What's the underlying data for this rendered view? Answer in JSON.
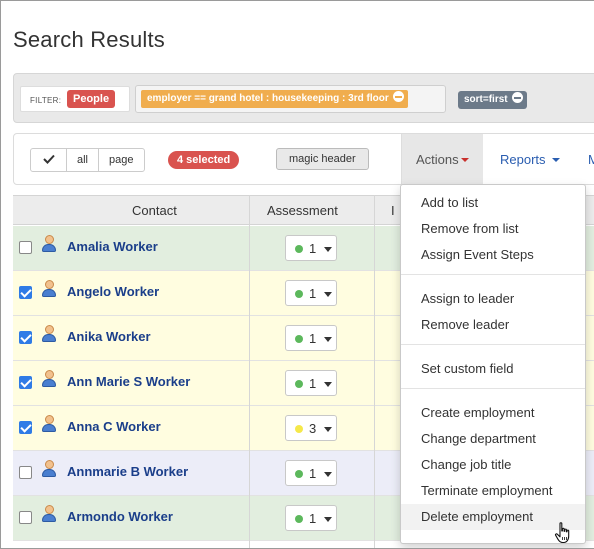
{
  "page": {
    "title": "Search Results"
  },
  "filters": {
    "label": "FILTER:",
    "people_tag": "People",
    "employer_filter": "employer == grand hotel : housekeeping : 3rd floor",
    "sort_tag": "sort=first"
  },
  "toolbar": {
    "check_icon": "checkmark-icon",
    "all_label": "all",
    "page_label": "page",
    "selected_badge": "4 selected",
    "magic_header_label": "magic header",
    "actions_label": "Actions",
    "reports_label": "Reports",
    "more_label": "M"
  },
  "table": {
    "headers": [
      "Contact",
      "Assessment",
      "I"
    ],
    "rows": [
      {
        "name": "Amalia Worker",
        "checked": false,
        "assessment": "1",
        "dot_color": "#5cb85c",
        "row_color": "green"
      },
      {
        "name": "Angelo Worker",
        "checked": true,
        "assessment": "1",
        "dot_color": "#5cb85c",
        "row_color": "yellow"
      },
      {
        "name": "Anika Worker",
        "checked": true,
        "assessment": "1",
        "dot_color": "#5cb85c",
        "row_color": "yellow"
      },
      {
        "name": "Ann Marie S Worker",
        "checked": true,
        "assessment": "1",
        "dot_color": "#5cb85c",
        "row_color": "yellow"
      },
      {
        "name": "Anna C Worker",
        "checked": true,
        "assessment": "3",
        "dot_color": "#f5e84a",
        "row_color": "yellow"
      },
      {
        "name": "Annmarie B Worker",
        "checked": false,
        "assessment": "1",
        "dot_color": "#5cb85c",
        "row_color": "blue"
      },
      {
        "name": "Armondo Worker",
        "checked": false,
        "assessment": "1",
        "dot_color": "#5cb85c",
        "row_color": "green"
      }
    ]
  },
  "actions_menu": {
    "groups": [
      [
        "Add to list",
        "Remove from list",
        "Assign Event Steps"
      ],
      [
        "Assign to leader",
        "Remove leader"
      ],
      [
        "Set custom field"
      ],
      [
        "Create employment",
        "Change department",
        "Change job title",
        "Terminate employment",
        "Delete employment"
      ]
    ],
    "hovered": "Delete employment"
  },
  "colors": {
    "danger": "#d9534f",
    "warning": "#f0ad4e",
    "link": "#1a3e8a",
    "checkbox_on": "#2f7be6"
  }
}
